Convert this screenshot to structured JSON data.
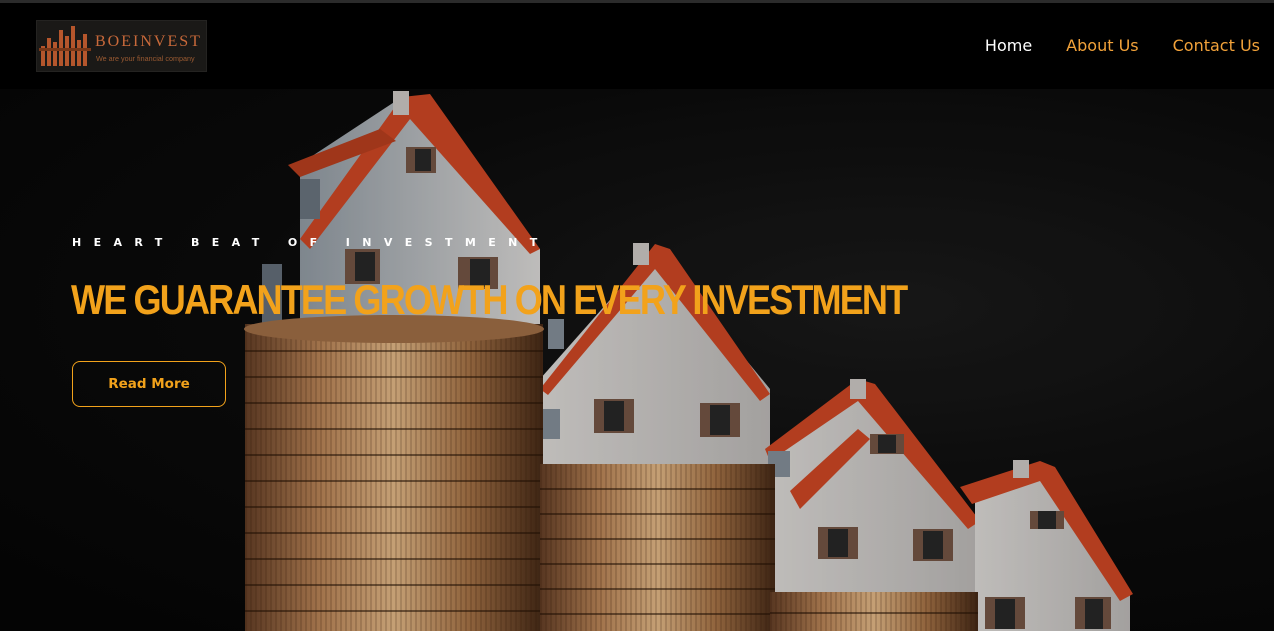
{
  "header": {
    "logo": {
      "brand": "BOEINVEST",
      "tagline": "We are your financial company"
    },
    "nav": [
      {
        "label": "Home"
      },
      {
        "label": "About Us"
      },
      {
        "label": "Contact Us"
      }
    ]
  },
  "hero": {
    "eyebrow": "HEART BEAT OF INVESTMENT",
    "headline": "WE GUARANTEE GROWTH ON EVERY INVESTMENT",
    "button_label": "Read More",
    "image_subject": "houses-on-coin-stacks"
  },
  "colors": {
    "accent": "#f2a21b",
    "nav_accent": "#f2a23a",
    "background": "#000000",
    "roof": "#e0542a"
  }
}
